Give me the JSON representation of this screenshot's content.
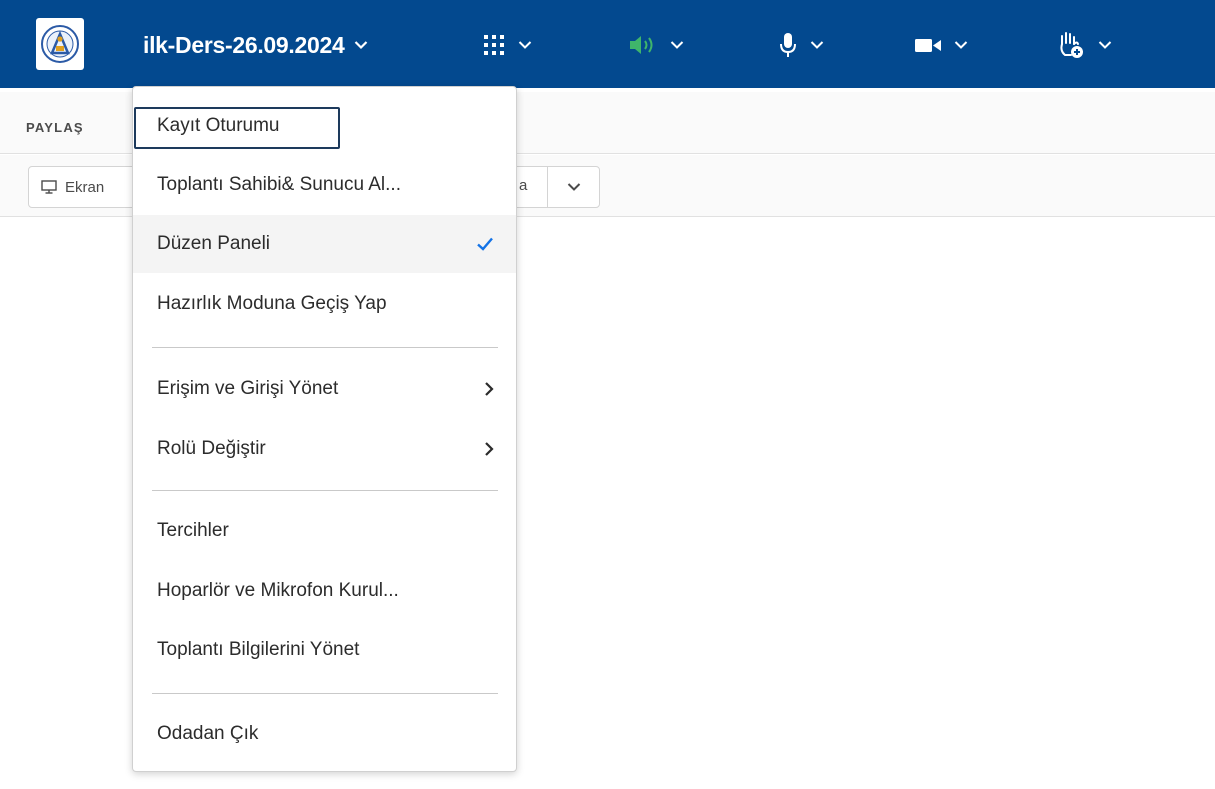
{
  "topbar": {
    "meeting_title": "ilk-Ders-26.09.2024",
    "colors": {
      "bar": "#03498f",
      "audio_active": "#3fb56b"
    },
    "controls": [
      {
        "icon": "apps-grid-icon"
      },
      {
        "icon": "speaker-icon"
      },
      {
        "icon": "microphone-icon"
      },
      {
        "icon": "camera-icon"
      },
      {
        "icon": "raise-hand-icon"
      }
    ]
  },
  "share_pod": {
    "title": "PAYLAŞ",
    "share_button_label": "Ekran",
    "share_button_tail": "a"
  },
  "menu": {
    "items": [
      {
        "label": "Kayıt Oturumu"
      },
      {
        "label": "Toplantı Sahibi& Sunucu Al..."
      },
      {
        "label": "Düzen Paneli",
        "checked": true
      },
      {
        "label": "Hazırlık Moduna Geçiş Yap"
      },
      {
        "label": "Erişim ve Girişi Yönet",
        "submenu": true
      },
      {
        "label": "Rolü Değiştir",
        "submenu": true
      },
      {
        "label": "Tercihler"
      },
      {
        "label": "Hoparlör ve Mikrofon Kurul..."
      },
      {
        "label": "Toplantı Bilgilerini Yönet"
      },
      {
        "label": "Odadan Çık"
      }
    ]
  }
}
